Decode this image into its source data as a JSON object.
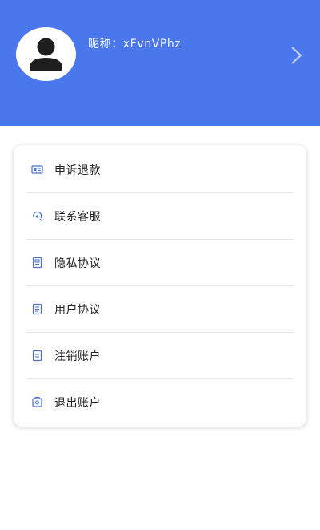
{
  "theme": {
    "header_color": "#4a77ec",
    "icon_color": "#4a6fd6"
  },
  "profile": {
    "nickname": "昵称：xFvnVPhz",
    "avatar_icon": "user-avatar-icon",
    "arrow_icon": "chevron-right-icon"
  },
  "menu": {
    "items": [
      {
        "label": "申诉退款",
        "icon": "id-card-icon"
      },
      {
        "label": "联系客服",
        "icon": "customer-service-icon"
      },
      {
        "label": "隐私协议",
        "icon": "privacy-document-icon"
      },
      {
        "label": "用户协议",
        "icon": "agreement-document-icon"
      },
      {
        "label": "注销账户",
        "icon": "cancel-account-icon"
      },
      {
        "label": "退出账户",
        "icon": "logout-icon"
      }
    ]
  }
}
